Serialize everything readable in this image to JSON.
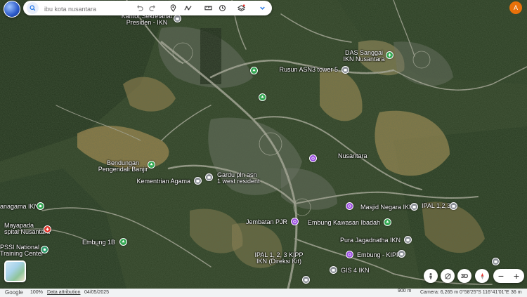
{
  "search": {
    "placeholder": "ibu kota nusantara"
  },
  "toolbar": {
    "undo_icon": "undo-icon",
    "redo_icon": "redo-icon",
    "pin_icon": "placemark-icon",
    "path_icon": "path-icon",
    "measure_icon": "ruler-icon",
    "history_icon": "history-icon",
    "layers_icon": "layers-icon",
    "more_icon": "chevron-down-icon"
  },
  "account": {
    "initial": "A",
    "color": "#e8710a"
  },
  "places": {
    "kantor": "Kantor Sekretariat",
    "kantor2": "Presiden - IKN",
    "das1": "DAS Sanggai",
    "das2": "IKN Nusantara",
    "rusun": "Rusun ASN3 tower 5",
    "nusantara": "Nusantara",
    "bendungan1": "Bendungan",
    "bendungan2": "Pengendali Banjir",
    "kementrian": "Kementrian Agama",
    "gardu1": "Gardu pln asn",
    "gardu2": "1 west resident",
    "manggala": "anagama IKN",
    "mayapada1": "Mayapada",
    "mayapada2": "spital Nusantara",
    "pssi1": "PSSI National",
    "pssi2": "Training Center",
    "embung1b": "Embung 1B",
    "jembatan": "Jembatan PJR",
    "masjid": "Masjid Negara IKN",
    "ipal123": "IPAL 1,2,3",
    "embungkawasan": "Embung Kawasan Ibadah",
    "pura": "Pura Jagadnatha IKN",
    "embungkipp": "Embung - KIPP",
    "ipalkipp1": "IPAL 1, 2, 3 KIPP",
    "ipalkipp2": "IKN (Direksi Kit)",
    "gis": "GIS 4 IKN"
  },
  "controls": {
    "view3d": "3D",
    "zoom_out": "−",
    "zoom_in": "+"
  },
  "status": {
    "brand": "Google",
    "zoom": "100%",
    "attribution": "Data attribution",
    "date": "04/05/2025",
    "scale": "900 m",
    "camera": "Camera: 6,265 m",
    "coords": "0°58'25\"S 116°41'01\"E",
    "elevation": "36 m"
  },
  "colors": {
    "forest": "#2c3e23",
    "clearing": "#b89a5a",
    "road": "#b9b6ad",
    "accent": "#1a73e8"
  }
}
